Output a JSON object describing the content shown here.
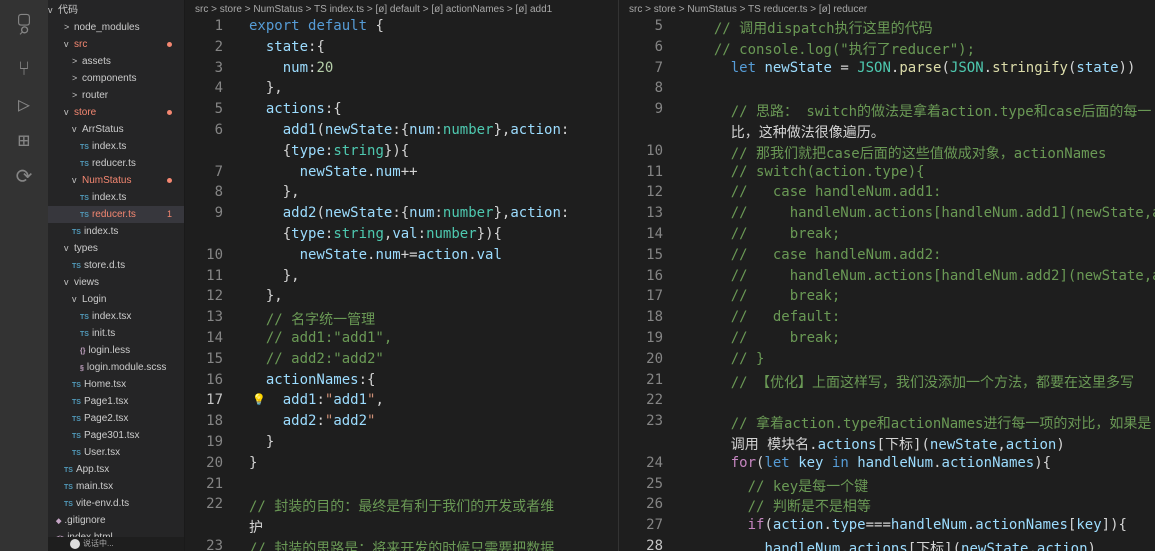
{
  "sidebar": {
    "root_label": "代码",
    "items": [
      {
        "label": "node_modules",
        "arrow": ">",
        "ts": false,
        "red": false,
        "dot": false,
        "badge": ""
      },
      {
        "label": "src",
        "arrow": "v",
        "ts": false,
        "red": true,
        "dot": true,
        "badge": ""
      },
      {
        "label": "assets",
        "arrow": ">",
        "ts": false,
        "red": false,
        "dot": false,
        "badge": ""
      },
      {
        "label": "components",
        "arrow": ">",
        "ts": false,
        "red": false,
        "dot": false,
        "badge": ""
      },
      {
        "label": "router",
        "arrow": ">",
        "ts": false,
        "red": false,
        "dot": false,
        "badge": ""
      },
      {
        "label": "store",
        "arrow": "v",
        "ts": false,
        "red": true,
        "dot": true,
        "badge": ""
      },
      {
        "label": "ArrStatus",
        "arrow": "v",
        "ts": false,
        "red": false,
        "dot": false,
        "badge": ""
      },
      {
        "label": "index.ts",
        "arrow": "",
        "ts": true,
        "red": false,
        "dot": false,
        "badge": ""
      },
      {
        "label": "reducer.ts",
        "arrow": "",
        "ts": true,
        "red": false,
        "dot": false,
        "badge": ""
      },
      {
        "label": "NumStatus",
        "arrow": "v",
        "ts": false,
        "red": true,
        "dot": true,
        "badge": ""
      },
      {
        "label": "index.ts",
        "arrow": "",
        "ts": true,
        "red": false,
        "dot": false,
        "badge": ""
      },
      {
        "label": "reducer.ts",
        "arrow": "",
        "ts": true,
        "red": true,
        "dot": false,
        "badge": "1"
      },
      {
        "label": "index.ts",
        "arrow": "",
        "ts": true,
        "red": false,
        "dot": false,
        "badge": ""
      },
      {
        "label": "types",
        "arrow": "v",
        "ts": false,
        "red": false,
        "dot": false,
        "badge": ""
      },
      {
        "label": "store.d.ts",
        "arrow": "",
        "ts": true,
        "red": false,
        "dot": false,
        "badge": ""
      },
      {
        "label": "views",
        "arrow": "v",
        "ts": false,
        "red": false,
        "dot": false,
        "badge": ""
      },
      {
        "label": "Login",
        "arrow": "v",
        "ts": false,
        "red": false,
        "dot": false,
        "badge": ""
      },
      {
        "label": "index.tsx",
        "arrow": "",
        "ts": true,
        "red": false,
        "dot": false,
        "badge": ""
      },
      {
        "label": "init.ts",
        "arrow": "",
        "ts": true,
        "red": false,
        "dot": false,
        "badge": ""
      },
      {
        "label": "login.less",
        "arrow": "",
        "ts": false,
        "red": false,
        "dot": false,
        "badge": "",
        "glyph": "{}"
      },
      {
        "label": "login.module.scss",
        "arrow": "",
        "ts": false,
        "red": false,
        "dot": false,
        "badge": "",
        "glyph": "§"
      },
      {
        "label": "Home.tsx",
        "arrow": "",
        "ts": true,
        "red": false,
        "dot": false,
        "badge": ""
      },
      {
        "label": "Page1.tsx",
        "arrow": "",
        "ts": true,
        "red": false,
        "dot": false,
        "badge": ""
      },
      {
        "label": "Page2.tsx",
        "arrow": "",
        "ts": true,
        "red": false,
        "dot": false,
        "badge": ""
      },
      {
        "label": "Page301.tsx",
        "arrow": "",
        "ts": true,
        "red": false,
        "dot": false,
        "badge": ""
      },
      {
        "label": "User.tsx",
        "arrow": "",
        "ts": true,
        "red": false,
        "dot": false,
        "badge": ""
      },
      {
        "label": "App.tsx",
        "arrow": "",
        "ts": true,
        "red": false,
        "dot": false,
        "badge": ""
      },
      {
        "label": "main.tsx",
        "arrow": "",
        "ts": true,
        "red": false,
        "dot": false,
        "badge": ""
      },
      {
        "label": "vite-env.d.ts",
        "arrow": "",
        "ts": true,
        "red": false,
        "dot": false,
        "badge": ""
      },
      {
        "label": ".gitignore",
        "arrow": "",
        "ts": false,
        "red": false,
        "dot": false,
        "badge": "",
        "glyph": "◆"
      },
      {
        "label": "index.html",
        "arrow": "",
        "ts": false,
        "red": false,
        "dot": false,
        "badge": "",
        "glyph": "<>"
      }
    ],
    "status_text": "说话中..."
  },
  "left_editor": {
    "breadcrumb": "src > store > NumStatus > TS index.ts > [ø] default > [ø] actionNames > [ø] add1",
    "line_numbers": [
      "1",
      "2",
      "3",
      "4",
      "5",
      "6",
      "",
      "7",
      "8",
      "9",
      "",
      "10",
      "11",
      "12",
      "13",
      "14",
      "15",
      "16",
      "17",
      "18",
      "19",
      "20",
      "21",
      "22",
      "",
      "23"
    ],
    "current_line": "17",
    "code_lines": [
      "export default {",
      "  state:{",
      "    num:20",
      "  },",
      "  actions:{",
      "    add1(newState:{num:number},action:",
      "    {type:string}){",
      "      newState.num++",
      "    },",
      "    add2(newState:{num:number},action:",
      "    {type:string,val:number}){",
      "      newState.num+=action.val",
      "    },",
      "  },",
      "  // 名字统一管理",
      "  // add1:\"add1\",",
      "  // add2:\"add2\"",
      "  actionNames:{",
      "    add1:\"add1\",",
      "    add2:\"add2\"",
      "  }",
      "}",
      "",
      "// 封装的目的：最终是有利于我们的开发或者维",
      "护",
      "// 封装的思路是：将来开发的时候只需要把数据"
    ]
  },
  "right_editor": {
    "breadcrumb": "src > store > NumStatus > TS reducer.ts > [ø] reducer",
    "line_numbers": [
      "5",
      "6",
      "7",
      "8",
      "9",
      "",
      "10",
      "11",
      "12",
      "13",
      "14",
      "15",
      "16",
      "17",
      "18",
      "19",
      "20",
      "21",
      "22",
      "23",
      "",
      "24",
      "25",
      "26",
      "27",
      "28"
    ],
    "current_line": "28",
    "code_lines": [
      "  // 调用dispatch执行这里的代码",
      "  // console.log(\"执行了reducer\");",
      "    let newState = JSON.parse(JSON.stringify(state))",
      "",
      "    // 思路： switch的做法是拿着action.type和case后面的每一",
      "    比，这种做法很像遍历。",
      "    // 那我们就把case后面的这些值做成对象，actionNames",
      "    // switch(action.type){",
      "    //   case handleNum.add1:",
      "    //     handleNum.actions[handleNum.add1](newState,ac",
      "    //     break;",
      "    //   case handleNum.add2:",
      "    //     handleNum.actions[handleNum.add2](newState,ac",
      "    //     break;",
      "    //   default:",
      "    //     break;",
      "    // }",
      "    // 【优化】上面这样写，我们没添加一个方法，都要在这里多写",
      "",
      "    // 拿着action.type和actionNames进行每一项的对比，如果是",
      "    调用 模块名.actions[下标](newState,action)",
      "    for(let key in handleNum.actionNames){",
      "      // key是每一个键",
      "      // 判断是不是相等",
      "      if(action.type===handleNum.actionNames[key]){",
      "        handleNum.actions[下标](newState,action)"
    ]
  }
}
